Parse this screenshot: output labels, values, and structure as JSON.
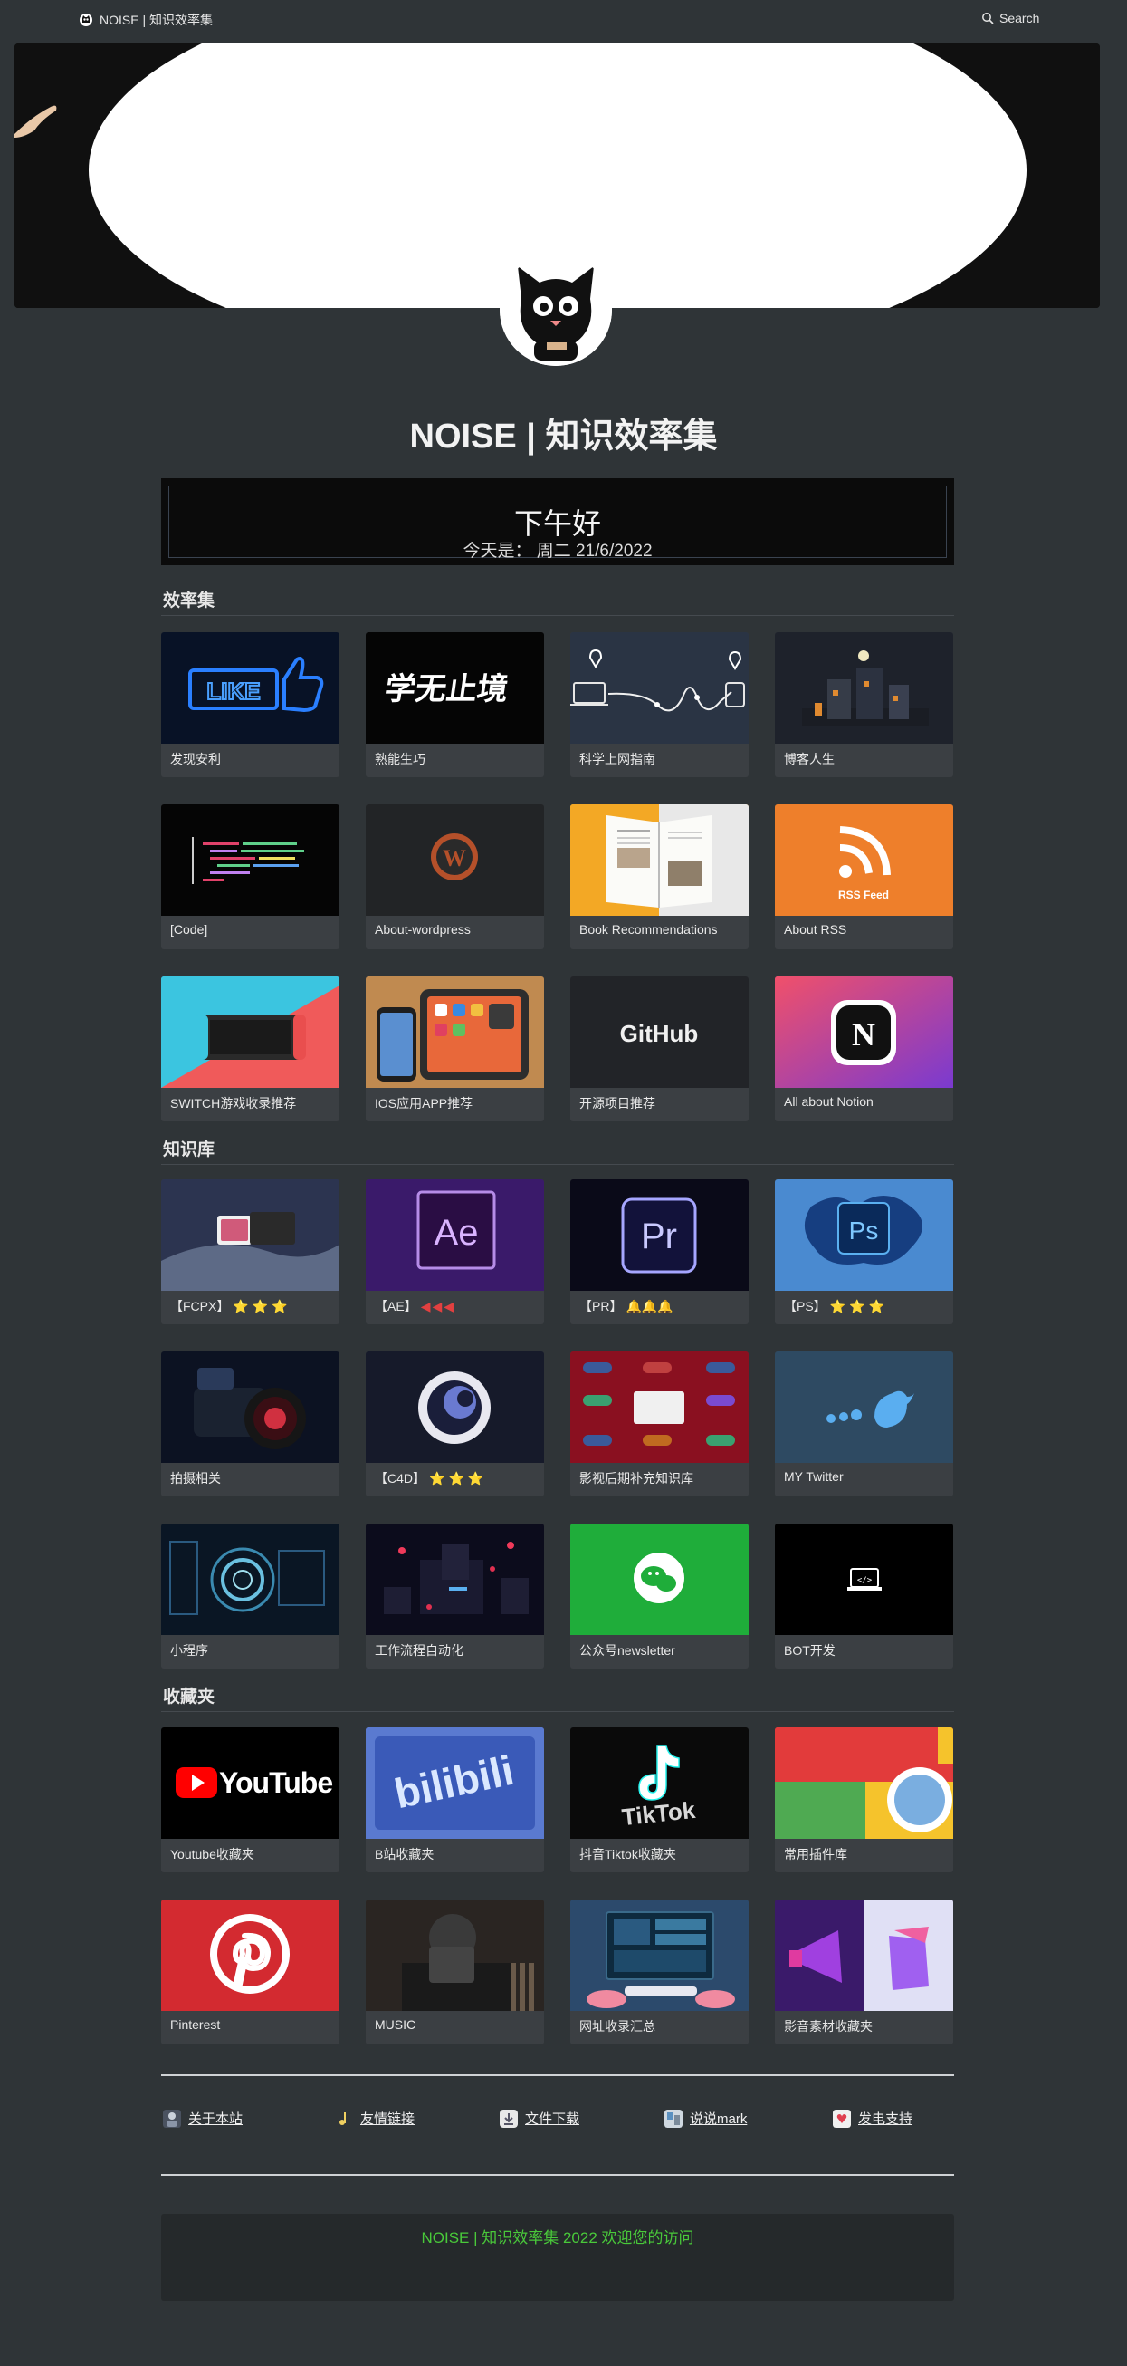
{
  "topbar": {
    "site_name": "NOISE | 知识效率集",
    "search_label": "Search"
  },
  "page": {
    "title": "NOISE | 知识效率集"
  },
  "greeting": {
    "main": "下午好",
    "date": "今天是： 周二 21/6/2022"
  },
  "sections": [
    {
      "title": "效率集",
      "cards": [
        {
          "label": "发现安利",
          "icon": "neon-like-thumb"
        },
        {
          "label": "熟能生巧",
          "icon": "calligraphy-text"
        },
        {
          "label": "科学上网指南",
          "icon": "network-route"
        },
        {
          "label": "博客人生",
          "icon": "night-town"
        },
        {
          "label": "[Code]",
          "icon": "code-editor"
        },
        {
          "label": "About-wordpress",
          "icon": "wordpress-logo"
        },
        {
          "label": "Book Recommendations",
          "icon": "open-book"
        },
        {
          "label": "About RSS",
          "icon": "rss-feed"
        },
        {
          "label": "SWITCH游戏收录推荐",
          "icon": "nintendo-switch"
        },
        {
          "label": "IOS应用APP推荐",
          "icon": "ipad-iphone"
        },
        {
          "label": "开源项目推荐",
          "icon": "github-logo",
          "text": "GitHub"
        },
        {
          "label": "All about Notion",
          "icon": "notion-logo"
        }
      ]
    },
    {
      "title": "知识库",
      "cards": [
        {
          "label": "【FCPX】",
          "suffix": "⭐⭐⭐",
          "suffix_type": "stars",
          "icon": "final-cut-pro"
        },
        {
          "label": "【AE】",
          "suffix": "◀◀◀",
          "suffix_type": "flags",
          "icon": "after-effects-logo",
          "text": "Ae"
        },
        {
          "label": "【PR】",
          "suffix": "🔔🔔🔔",
          "suffix_type": "bells",
          "icon": "premiere-logo",
          "text": "Pr"
        },
        {
          "label": "【PS】",
          "suffix": "⭐⭐⭐",
          "suffix_type": "stars",
          "icon": "photoshop-logo",
          "text": "Ps"
        },
        {
          "label": "拍摄相关",
          "icon": "camera"
        },
        {
          "label": "【C4D】",
          "suffix": "⭐⭐⭐",
          "suffix_type": "stars",
          "icon": "cinema4d-logo"
        },
        {
          "label": "影视后期补充知识库",
          "icon": "adobe-apps"
        },
        {
          "label": "MY Twitter",
          "icon": "twitter-birds"
        },
        {
          "label": "小程序",
          "icon": "tech-circle"
        },
        {
          "label": "工作流程自动化",
          "icon": "neon-city"
        },
        {
          "label": "公众号newsletter",
          "icon": "wechat-logo"
        },
        {
          "label": "BOT开发",
          "icon": "code-laptop"
        }
      ]
    },
    {
      "title": "收藏夹",
      "cards": [
        {
          "label": "Youtube收藏夹",
          "icon": "youtube-logo",
          "text": "YouTube"
        },
        {
          "label": "B站收藏夹",
          "icon": "bilibili-logo",
          "text": "bilibili"
        },
        {
          "label": "抖音Tiktok收藏夹",
          "icon": "tiktok-logo",
          "text": "TikTok"
        },
        {
          "label": "常用插件库",
          "icon": "chrome-logo"
        },
        {
          "label": "Pinterest",
          "icon": "pinterest-logo"
        },
        {
          "label": "MUSIC",
          "icon": "music-dj"
        },
        {
          "label": "网址收录汇总",
          "icon": "computer-desk"
        },
        {
          "label": "影音素材收藏夹",
          "icon": "megaphone-3d"
        }
      ]
    }
  ],
  "footer": {
    "links": [
      {
        "label": "关于本站",
        "icon": "person-icon"
      },
      {
        "label": "友情链接",
        "icon": "music-note-icon"
      },
      {
        "label": "文件下载",
        "icon": "download-icon"
      },
      {
        "label": "说说mark",
        "icon": "mark-icon"
      },
      {
        "label": "发电支持",
        "icon": "support-icon"
      }
    ],
    "text": "NOISE | 知识效率集 2022 欢迎您的访问"
  },
  "colors": {
    "background": "#2f3437",
    "card": "#3b3f43",
    "footer_text": "#49c93a"
  }
}
